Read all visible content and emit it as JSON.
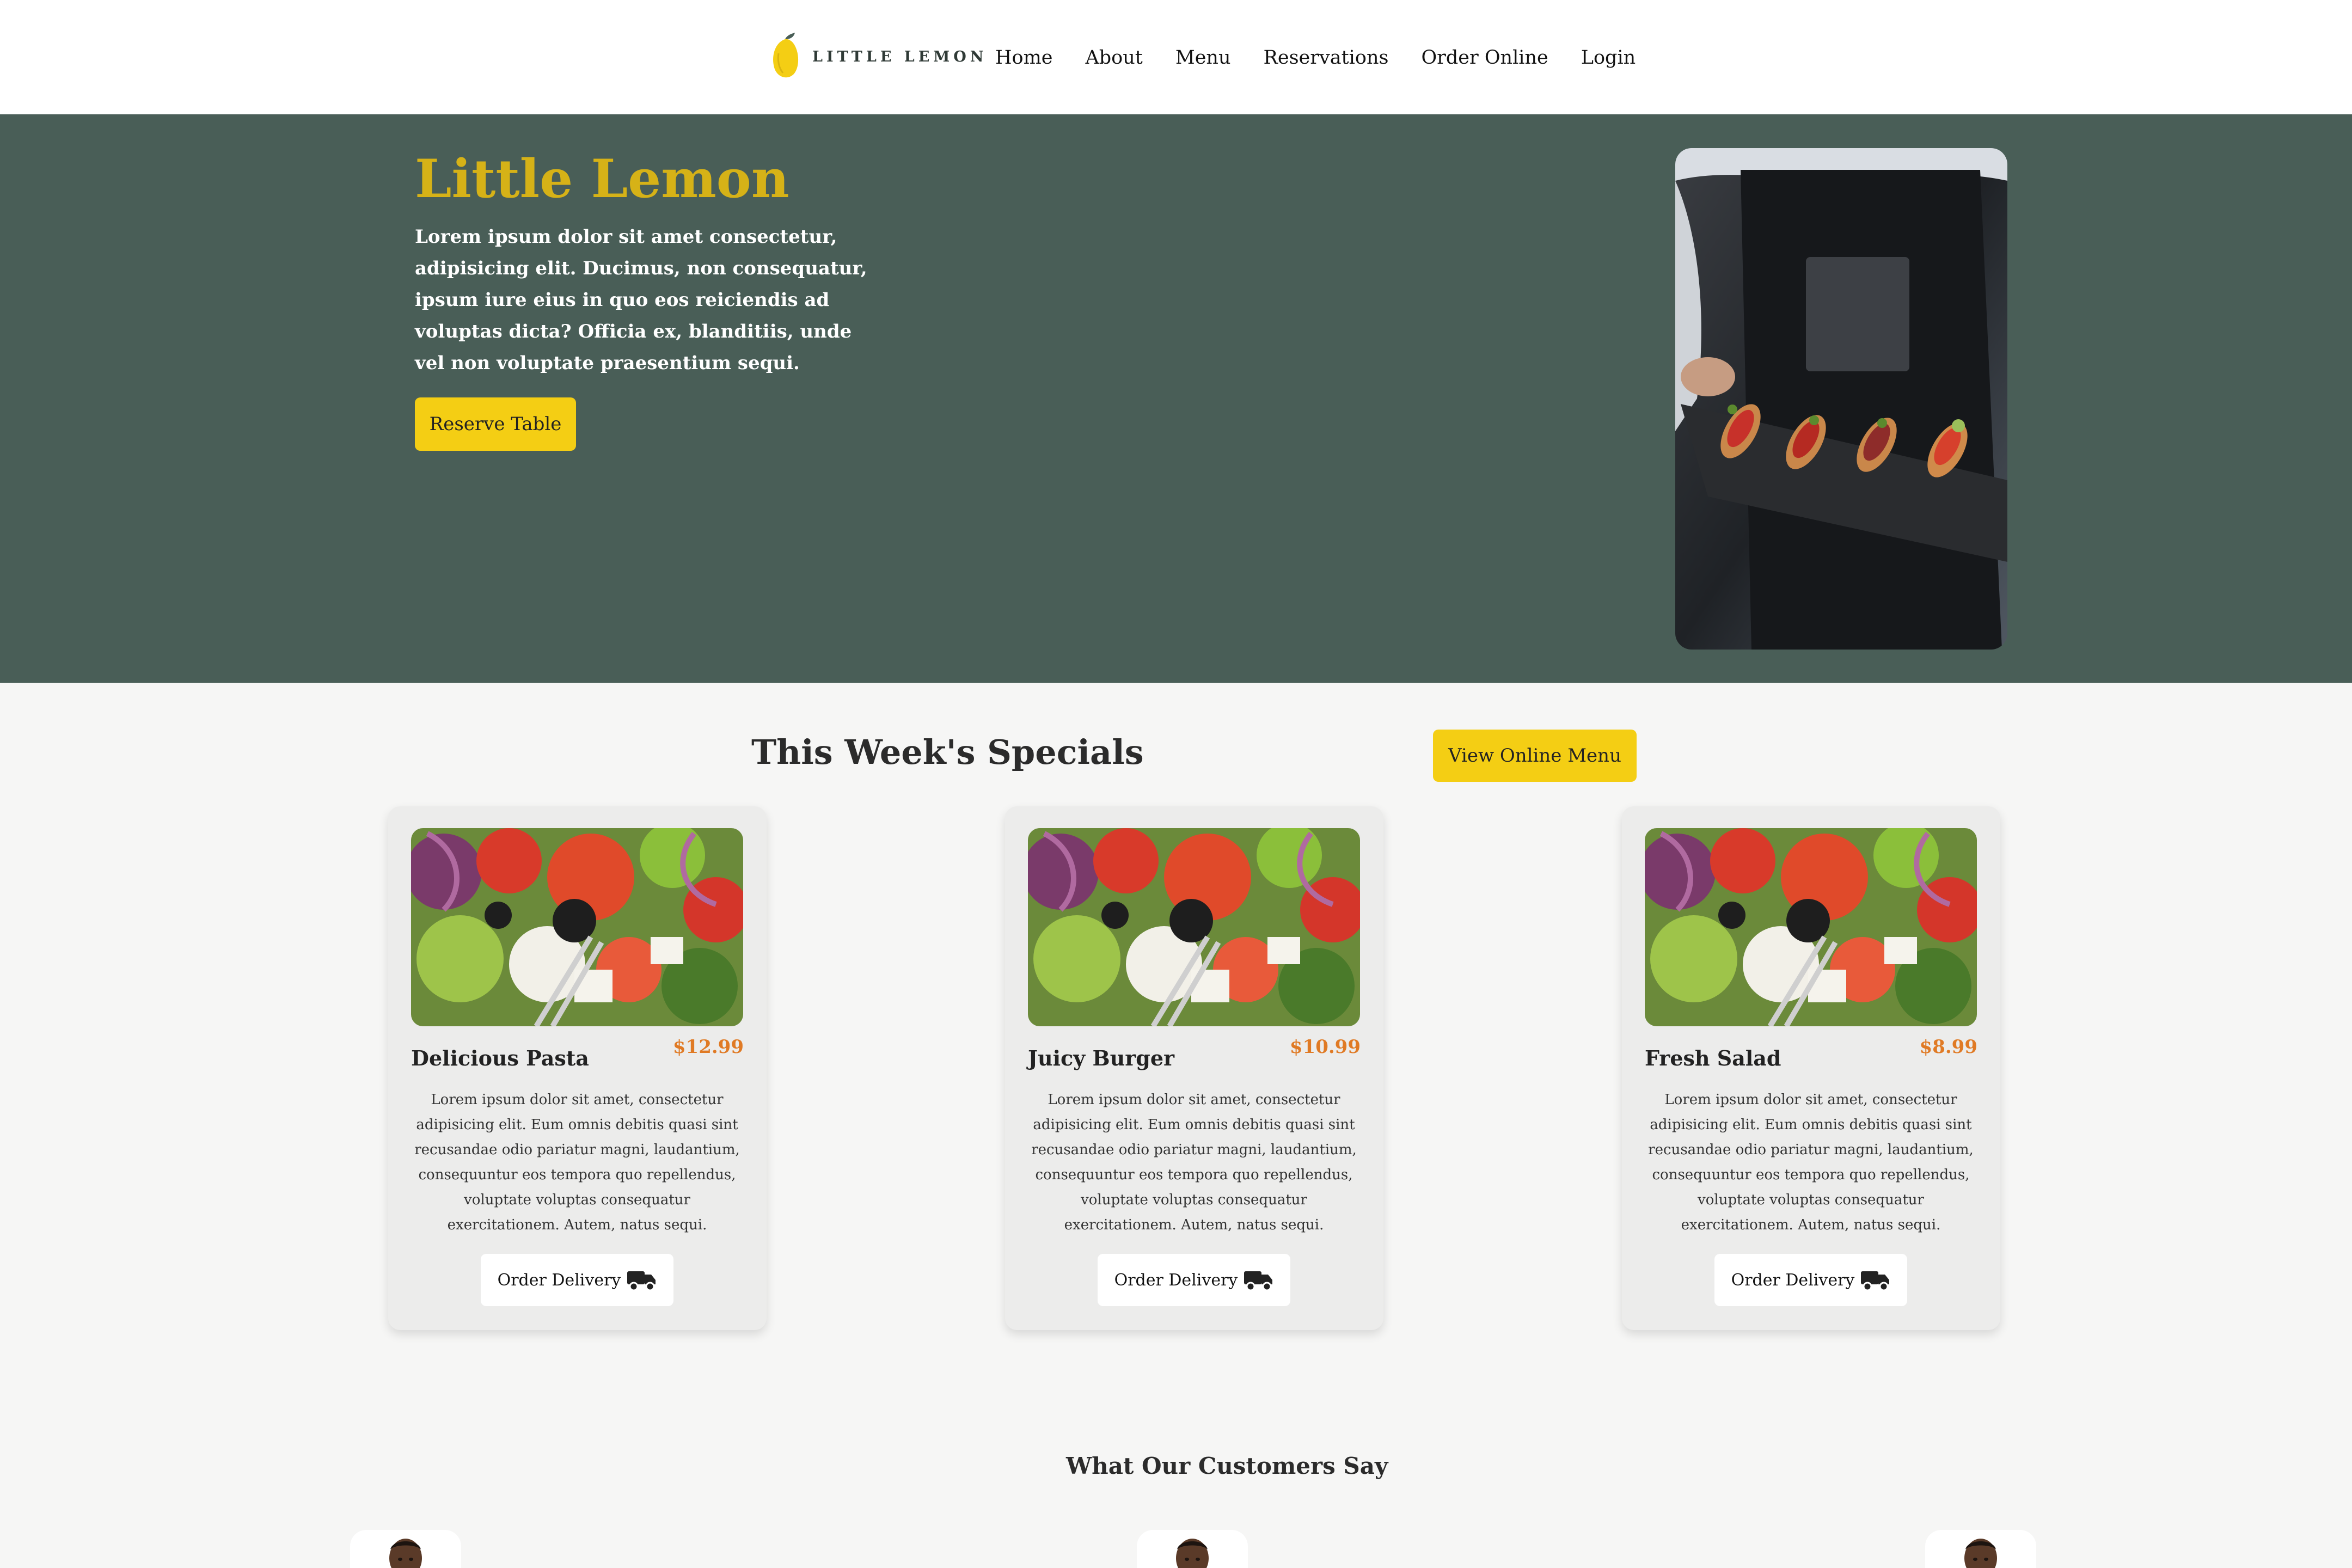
{
  "brand": {
    "logo_text": "LITTLE LEMON",
    "primary_color": "#495e57",
    "accent_color": "#f4ce14",
    "price_color": "#e07a24"
  },
  "nav": {
    "items": [
      "Home",
      "About",
      "Menu",
      "Reservations",
      "Order Online",
      "Login"
    ]
  },
  "hero": {
    "title": "Little Lemon",
    "description": "Lorem ipsum dolor sit amet consectetur, adipisicing elit. Ducimus, non consequatur, ipsum iure eius in quo eos reiciendis ad voluptas dicta? Officia ex, blanditiis, unde vel non voluptate praesentium sequi.",
    "button_label": "Reserve Table"
  },
  "specials": {
    "title": "This Week's Specials",
    "menu_button_label": "View Online Menu",
    "items": [
      {
        "name": "Delicious Pasta",
        "price": "$12.99",
        "description": "Lorem ipsum dolor sit amet, consectetur adipisicing elit. Eum omnis debitis quasi sint recusandae odio pariatur magni, laudantium, consequuntur eos tempora quo repellendus, voluptate voluptas consequatur exercitationem. Autem, natus sequi.",
        "button_label": "Order Delivery"
      },
      {
        "name": "Juicy Burger",
        "price": "$10.99",
        "description": "Lorem ipsum dolor sit amet, consectetur adipisicing elit. Eum omnis debitis quasi sint recusandae odio pariatur magni, laudantium, consequuntur eos tempora quo repellendus, voluptate voluptas consequatur exercitationem. Autem, natus sequi.",
        "button_label": "Order Delivery"
      },
      {
        "name": "Fresh Salad",
        "price": "$8.99",
        "description": "Lorem ipsum dolor sit amet, consectetur adipisicing elit. Eum omnis debitis quasi sint recusandae odio pariatur magni, laudantium, consequuntur eos tempora quo repellendus, voluptate voluptas consequatur exercitationem. Autem, natus sequi.",
        "button_label": "Order Delivery"
      }
    ]
  },
  "testimonials": {
    "title": "What Our Customers Say"
  }
}
